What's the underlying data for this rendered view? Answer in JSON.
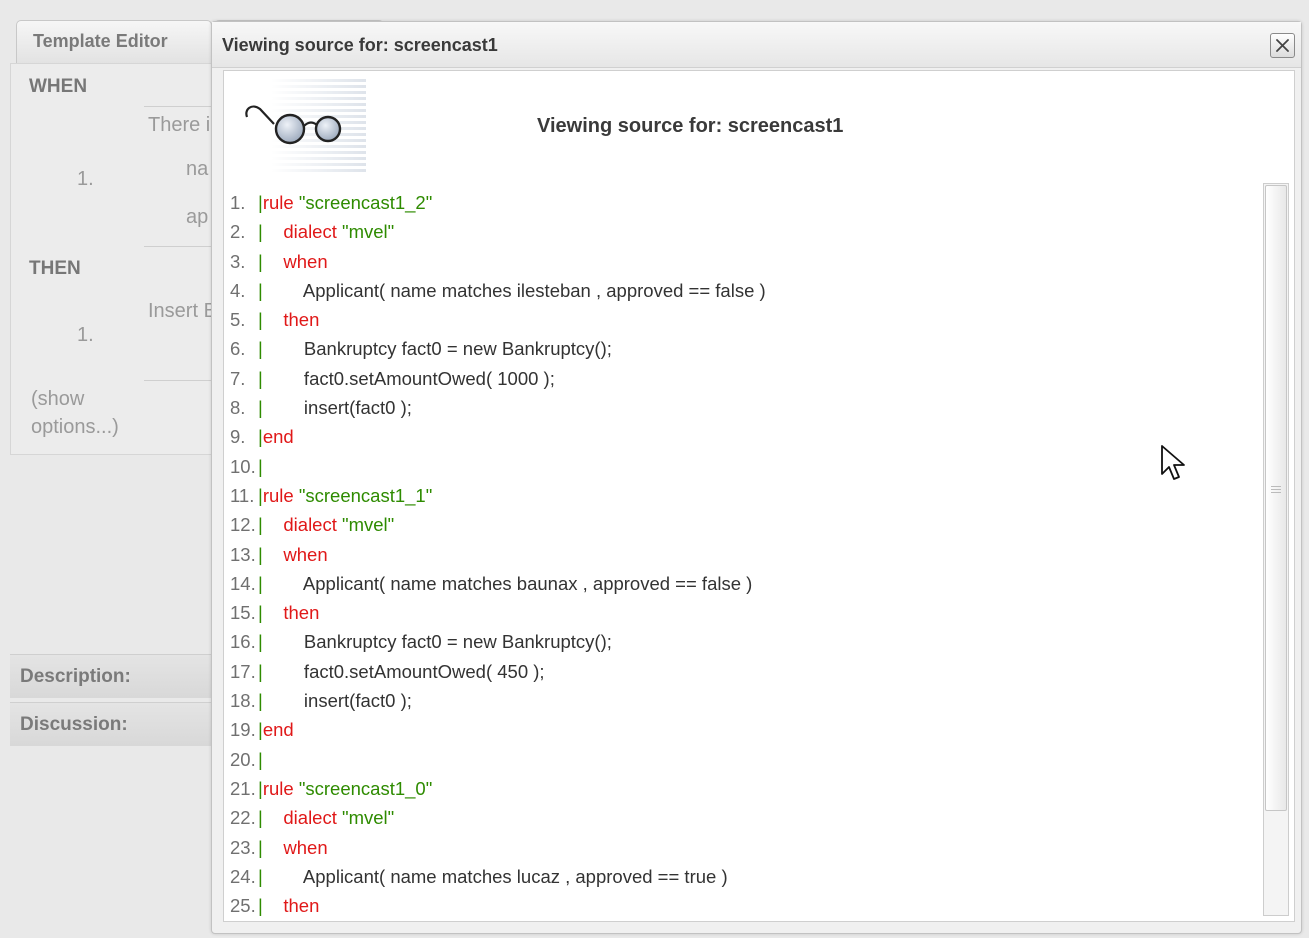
{
  "background": {
    "tabs": [
      "Template Editor",
      ""
    ],
    "when_label": "WHEN",
    "then_label": "THEN",
    "when_fragments": [
      "There i",
      "na",
      "ap"
    ],
    "when_number": "1.",
    "then_fragment": "Insert B",
    "then_number": "1.",
    "show_options": [
      "(show",
      "options...)"
    ],
    "description_label": "Description:",
    "discussion_label": "Discussion:"
  },
  "modal": {
    "title": "Viewing source for: screencast1",
    "header_title": "Viewing source for: screencast1",
    "icon": "glasses-icon",
    "close_icon": "close-icon"
  },
  "code_lines": [
    {
      "n": "1. ",
      "bar": "|",
      "parts": [
        [
          "kw",
          "rule "
        ],
        [
          "str",
          "\"screencast1_2\""
        ]
      ]
    },
    {
      "n": "2. ",
      "bar": "|",
      "parts": [
        [
          "txt",
          "    "
        ],
        [
          "kw",
          "dialect "
        ],
        [
          "str",
          "\"mvel\""
        ]
      ]
    },
    {
      "n": "3. ",
      "bar": "|",
      "parts": [
        [
          "txt",
          "    "
        ],
        [
          "kw",
          "when"
        ]
      ]
    },
    {
      "n": "4. ",
      "bar": "|",
      "parts": [
        [
          "txt",
          "        Applicant( name matches ilesteban , approved == false )"
        ]
      ]
    },
    {
      "n": "5. ",
      "bar": "|",
      "parts": [
        [
          "txt",
          "    "
        ],
        [
          "kw",
          "then"
        ]
      ]
    },
    {
      "n": "6. ",
      "bar": "|",
      "parts": [
        [
          "txt",
          "        Bankruptcy fact0 = new Bankruptcy();"
        ]
      ]
    },
    {
      "n": "7. ",
      "bar": "|",
      "parts": [
        [
          "txt",
          "        fact0.setAmountOwed( 1000 );"
        ]
      ]
    },
    {
      "n": "8. ",
      "bar": "|",
      "parts": [
        [
          "txt",
          "        insert(fact0 );"
        ]
      ]
    },
    {
      "n": "9. ",
      "bar": "|",
      "parts": [
        [
          "kw",
          "end"
        ]
      ]
    },
    {
      "n": "10.",
      "bar": "|",
      "parts": []
    },
    {
      "n": "11.",
      "bar": "|",
      "parts": [
        [
          "kw",
          "rule "
        ],
        [
          "str",
          "\"screencast1_1\""
        ]
      ]
    },
    {
      "n": "12.",
      "bar": "|",
      "parts": [
        [
          "txt",
          "    "
        ],
        [
          "kw",
          "dialect "
        ],
        [
          "str",
          "\"mvel\""
        ]
      ]
    },
    {
      "n": "13.",
      "bar": "|",
      "parts": [
        [
          "txt",
          "    "
        ],
        [
          "kw",
          "when"
        ]
      ]
    },
    {
      "n": "14.",
      "bar": "|",
      "parts": [
        [
          "txt",
          "        Applicant( name matches baunax , approved == false )"
        ]
      ]
    },
    {
      "n": "15.",
      "bar": "|",
      "parts": [
        [
          "txt",
          "    "
        ],
        [
          "kw",
          "then"
        ]
      ]
    },
    {
      "n": "16.",
      "bar": "|",
      "parts": [
        [
          "txt",
          "        Bankruptcy fact0 = new Bankruptcy();"
        ]
      ]
    },
    {
      "n": "17.",
      "bar": "|",
      "parts": [
        [
          "txt",
          "        fact0.setAmountOwed( 450 );"
        ]
      ]
    },
    {
      "n": "18.",
      "bar": "|",
      "parts": [
        [
          "txt",
          "        insert(fact0 );"
        ]
      ]
    },
    {
      "n": "19.",
      "bar": "|",
      "parts": [
        [
          "kw",
          "end"
        ]
      ]
    },
    {
      "n": "20.",
      "bar": "|",
      "parts": []
    },
    {
      "n": "21.",
      "bar": "|",
      "parts": [
        [
          "kw",
          "rule "
        ],
        [
          "str",
          "\"screencast1_0\""
        ]
      ]
    },
    {
      "n": "22.",
      "bar": "|",
      "parts": [
        [
          "txt",
          "    "
        ],
        [
          "kw",
          "dialect "
        ],
        [
          "str",
          "\"mvel\""
        ]
      ]
    },
    {
      "n": "23.",
      "bar": "|",
      "parts": [
        [
          "txt",
          "    "
        ],
        [
          "kw",
          "when"
        ]
      ]
    },
    {
      "n": "24.",
      "bar": "|",
      "parts": [
        [
          "txt",
          "        Applicant( name matches lucaz , approved == true )"
        ]
      ]
    },
    {
      "n": "25.",
      "bar": "|",
      "parts": [
        [
          "txt",
          "    "
        ],
        [
          "kw",
          "then"
        ]
      ]
    }
  ],
  "colors": {
    "keyword": "#e01818",
    "string": "#2e8b00",
    "gutter_bar": "#2e8b00",
    "text": "#333333"
  }
}
